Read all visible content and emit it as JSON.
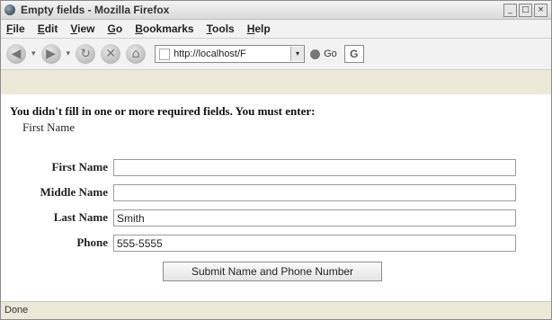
{
  "window": {
    "title": "Empty fields - Mozilla Firefox"
  },
  "menu": {
    "items": [
      "File",
      "Edit",
      "View",
      "Go",
      "Bookmarks",
      "Tools",
      "Help"
    ]
  },
  "nav": {
    "url": "http://localhost/F",
    "go_label": "Go",
    "search_icon_label": "G"
  },
  "page": {
    "error_message": "You didn't fill in one or more required fields. You must enter:",
    "missing_field": "First Name",
    "fields": [
      {
        "label": "First Name",
        "value": ""
      },
      {
        "label": "Middle Name",
        "value": ""
      },
      {
        "label": "Last Name",
        "value": "Smith"
      },
      {
        "label": "Phone",
        "value": "555-5555"
      }
    ],
    "submit_label": "Submit Name and Phone Number"
  },
  "status": {
    "text": "Done"
  }
}
